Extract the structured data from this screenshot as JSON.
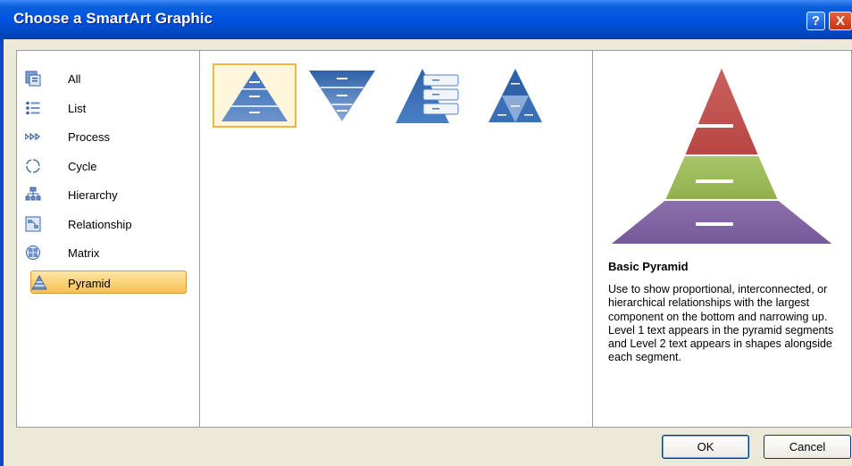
{
  "dialog": {
    "title": "Choose a SmartArt Graphic"
  },
  "titlebar_buttons": {
    "help": "?",
    "close": "X"
  },
  "categories": [
    {
      "label": "All",
      "icon": "all-icon",
      "selected": false
    },
    {
      "label": "List",
      "icon": "list-icon",
      "selected": false
    },
    {
      "label": "Process",
      "icon": "process-icon",
      "selected": false
    },
    {
      "label": "Cycle",
      "icon": "cycle-icon",
      "selected": false
    },
    {
      "label": "Hierarchy",
      "icon": "hierarchy-icon",
      "selected": false
    },
    {
      "label": "Relationship",
      "icon": "relationship-icon",
      "selected": false
    },
    {
      "label": "Matrix",
      "icon": "matrix-icon",
      "selected": false
    },
    {
      "label": "Pyramid",
      "icon": "pyramid-icon",
      "selected": true
    }
  ],
  "gallery": {
    "selected_index": 0,
    "items": [
      {
        "icon": "basic-pyramid-thumbnail-icon"
      },
      {
        "icon": "inverted-pyramid-thumbnail-icon"
      },
      {
        "icon": "pyramid-list-thumbnail-icon"
      },
      {
        "icon": "segmented-pyramid-thumbnail-icon"
      }
    ]
  },
  "preview": {
    "title": "Basic Pyramid",
    "description": "Use to show proportional, interconnected, or hierarchical relationships with the largest component on the bottom and narrowing up. Level 1 text appears in the pyramid segments and Level 2 text appears in shapes alongside each segment.",
    "colors": {
      "top": "#c0504d",
      "middle": "#9bbb59",
      "bottom": "#8064a2"
    }
  },
  "buttons": {
    "ok": "OK",
    "cancel": "Cancel"
  },
  "colors": {
    "title_bar": "#0054e3",
    "dialog_background": "#ece9d8",
    "selection": "#fbd27a",
    "thumbnail_blue": "#2e62a8"
  }
}
